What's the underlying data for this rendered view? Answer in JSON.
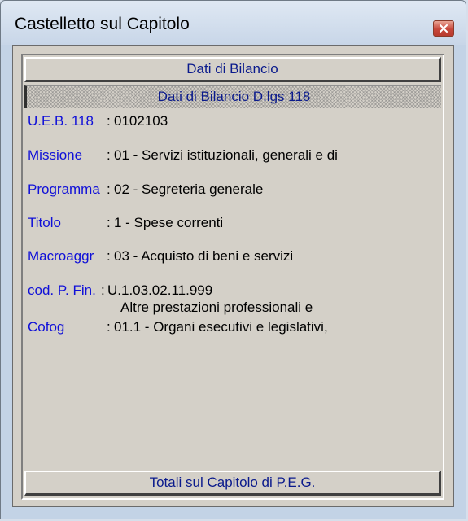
{
  "window": {
    "title": "Castelletto sul Capitolo"
  },
  "buttons": {
    "top": "Dati di Bilancio",
    "bottom": "Totali sul Capitolo di P.E.G."
  },
  "section": {
    "header": "Dati di Bilancio D.lgs 118"
  },
  "fields": {
    "ueb": {
      "label": "U.E.B. 118",
      "sep": ":",
      "value": "0102103"
    },
    "missione": {
      "label": "Missione",
      "sep": ":",
      "value": "01 - Servizi istituzionali, generali e di"
    },
    "programma": {
      "label": "Programma",
      "sep": ":",
      "value": "02 - Segreteria generale"
    },
    "titolo": {
      "label": "Titolo",
      "sep": ":",
      "value": "1 - Spese correnti"
    },
    "macroaggr": {
      "label": "Macroaggr",
      "sep": ":",
      "value": "03 - Acquisto di beni e servizi"
    },
    "codpfin": {
      "label": "cod. P. Fin.",
      "sep": ":",
      "value": "U.1.03.02.11.999",
      "value2": "Altre prestazioni professionali e"
    },
    "cofog": {
      "label": "Cofog",
      "sep": ":",
      "value": "01.1 - Organi esecutivi e legislativi,"
    }
  }
}
